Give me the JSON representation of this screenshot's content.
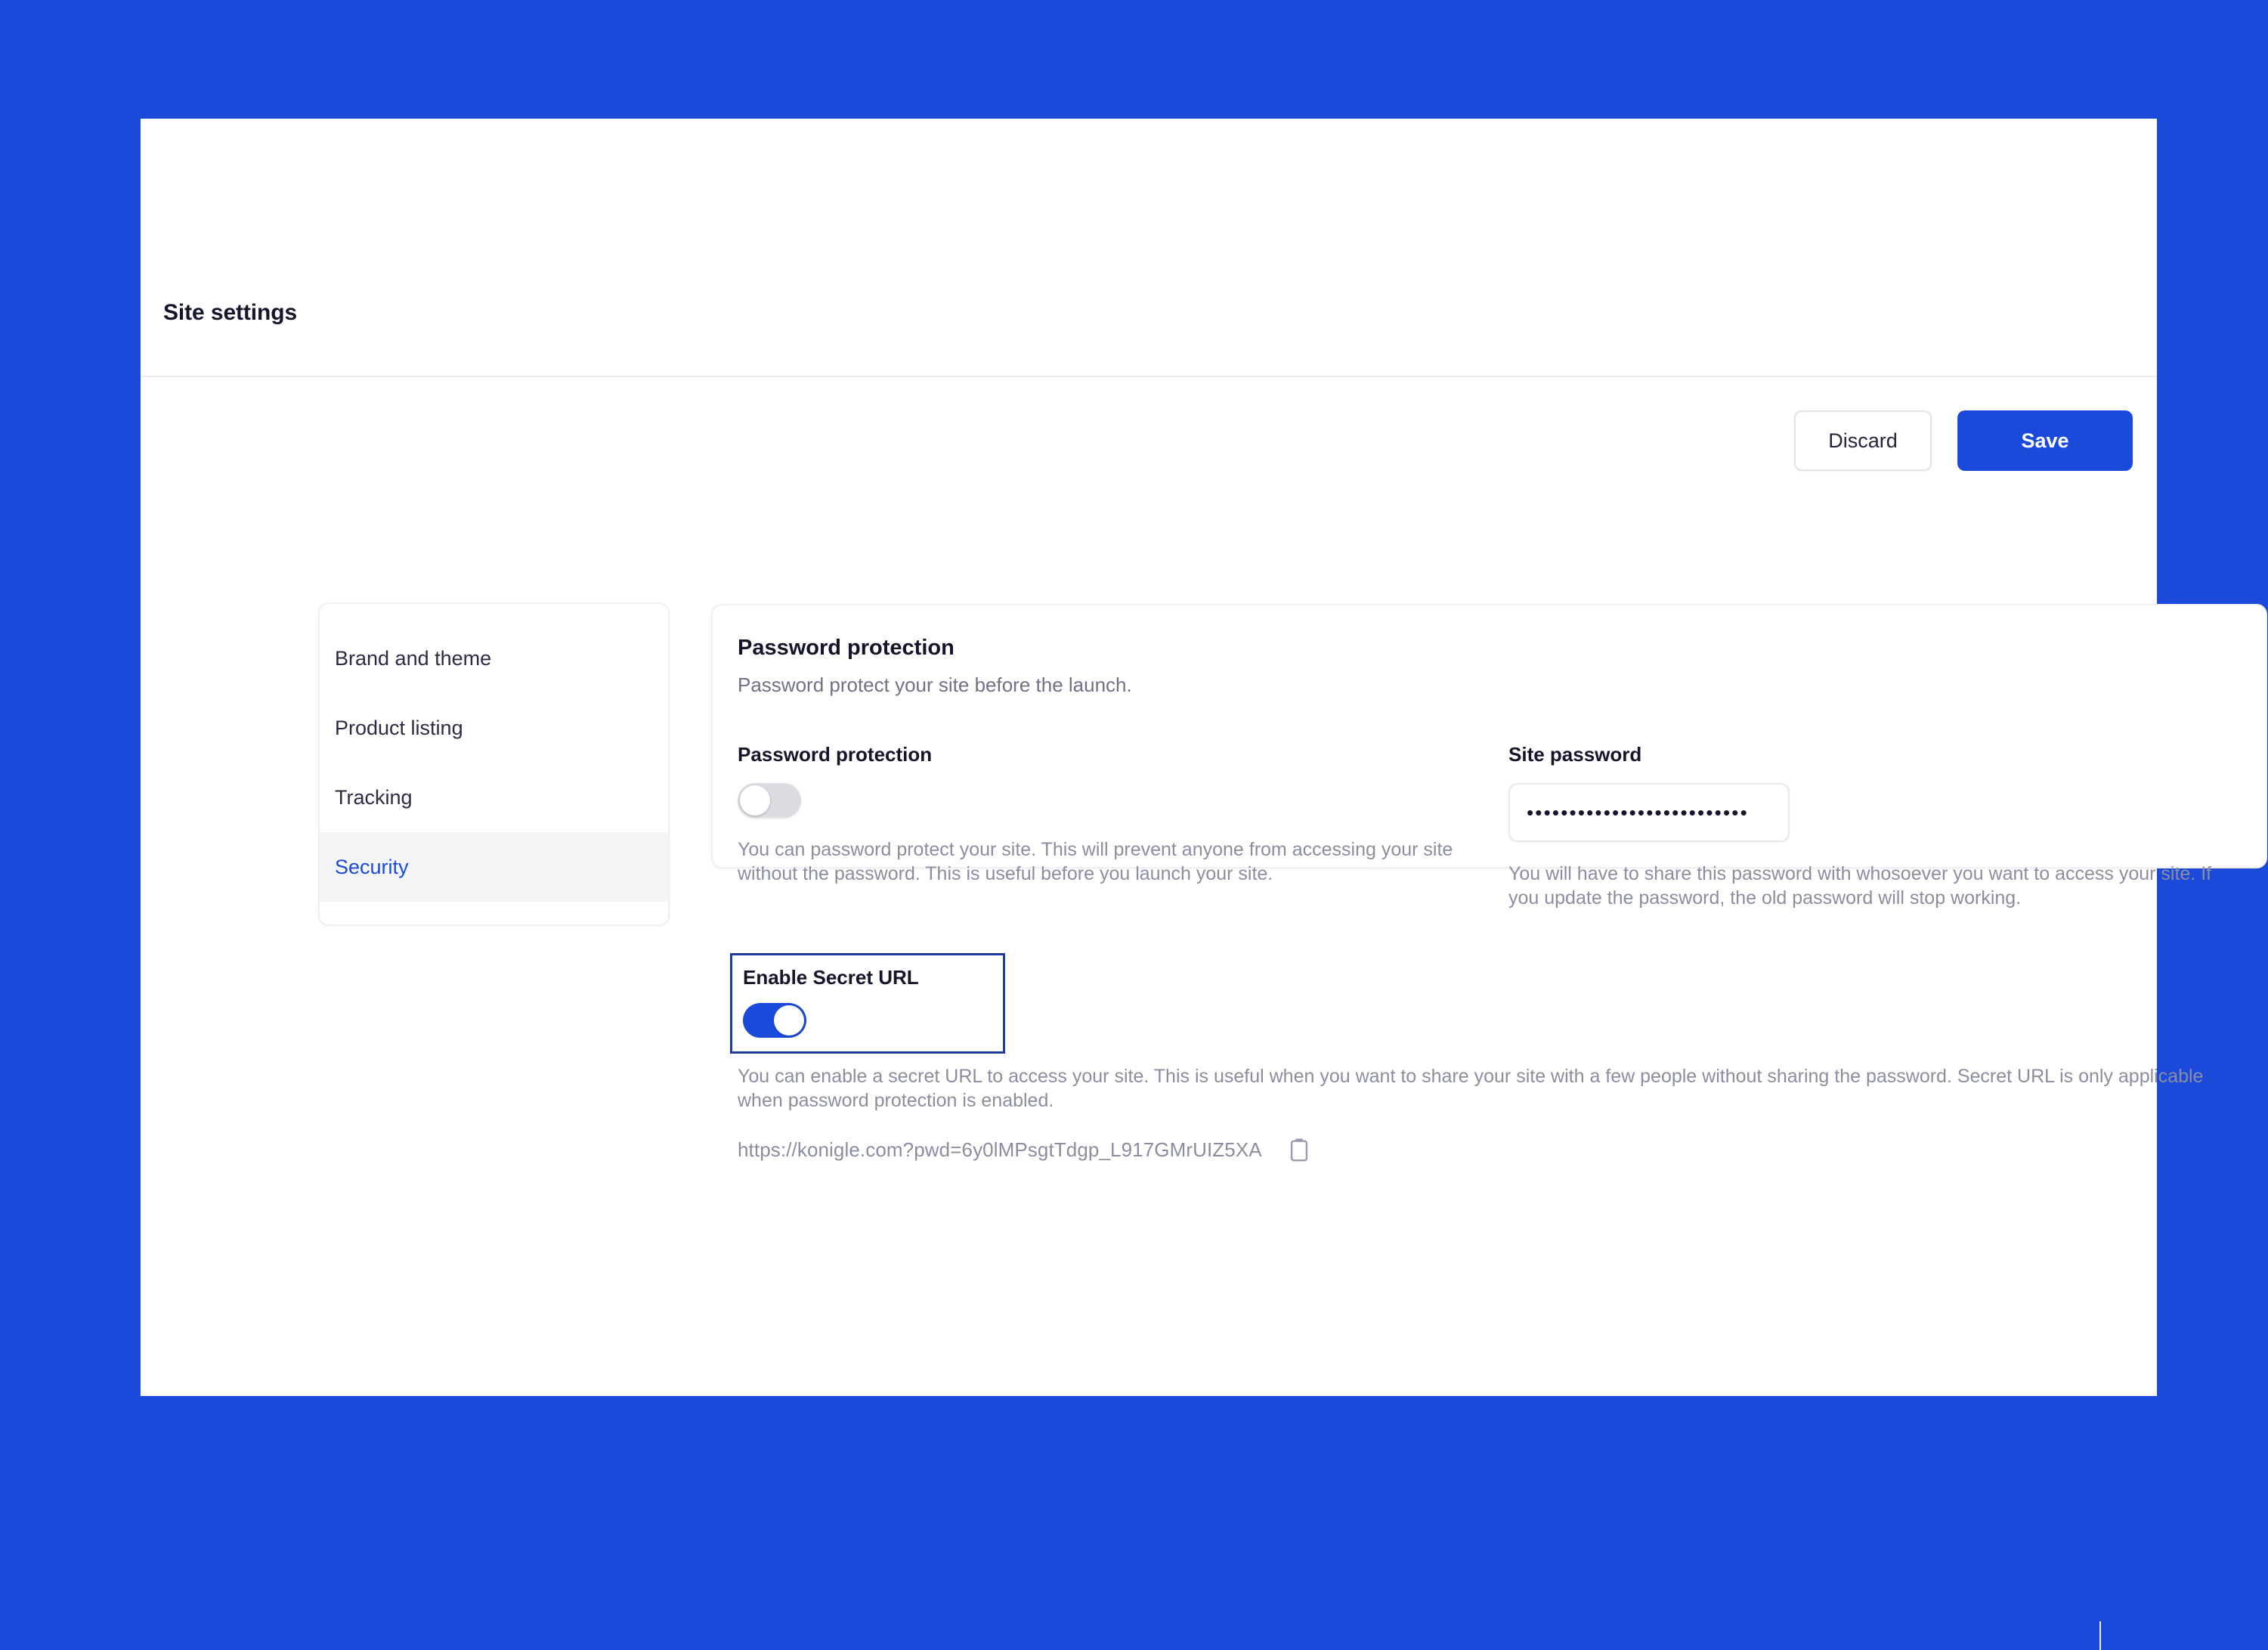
{
  "theme": {
    "accent": "#1b4adb",
    "page_background": "#1b4adb",
    "surface": "#ffffff",
    "focus_outline": "#203c9e",
    "muted_text": "#8b8da0",
    "toggle_off": "#dcdde3"
  },
  "header": {
    "title": "Site settings"
  },
  "actions": {
    "discard_label": "Discard",
    "save_label": "Save"
  },
  "sidebar": {
    "items": [
      {
        "label": "Brand and theme",
        "active": false
      },
      {
        "label": "Product listing",
        "active": false
      },
      {
        "label": "Tracking",
        "active": false
      },
      {
        "label": "Security",
        "active": true
      }
    ]
  },
  "main": {
    "section": {
      "title": "Password protection",
      "subtitle": "Password protect your site before the launch."
    },
    "password_protection": {
      "label": "Password protection",
      "toggle_state": "off",
      "help": "You can password protect your site. This will prevent anyone from accessing your site without the password. This is useful before you launch your site."
    },
    "site_password": {
      "label": "Site password",
      "value": "••••••••••••••••••••••••••",
      "placeholder": "Site password",
      "help": "You will have to share this password with whosoever you want to access your site. If you update the password, the old password will stop working."
    },
    "secret_url": {
      "label": "Enable Secret URL",
      "toggle_state": "on",
      "help": "You can enable a secret URL to access your site. This is useful when you want to share your site with a few people without sharing the password. Secret URL is only applicable when password protection is enabled.",
      "url": "https://konigle.com?pwd=6y0lMPsgtTdgp_L917GMrUIZ5XA",
      "copy_icon": "clipboard-icon"
    }
  }
}
